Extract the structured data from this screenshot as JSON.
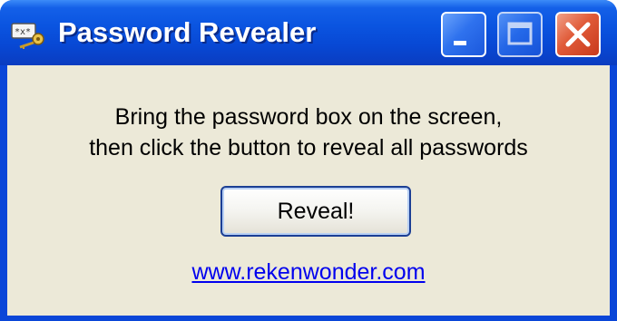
{
  "window": {
    "title": "Password Revealer",
    "buttons": {
      "minimize": "minimize-icon",
      "maximize": "maximize-icon",
      "close": "close-icon"
    }
  },
  "main": {
    "instruction_line1": "Bring the password box on the screen,",
    "instruction_line2": "then click the button to reveal all passwords",
    "reveal_button_label": "Reveal!",
    "website_link": "www.rekenwonder.com"
  },
  "colors": {
    "titlebar": "#0a54e0",
    "client_background": "#ece9d8",
    "close_button": "#e05a38",
    "link": "#0000ee"
  }
}
